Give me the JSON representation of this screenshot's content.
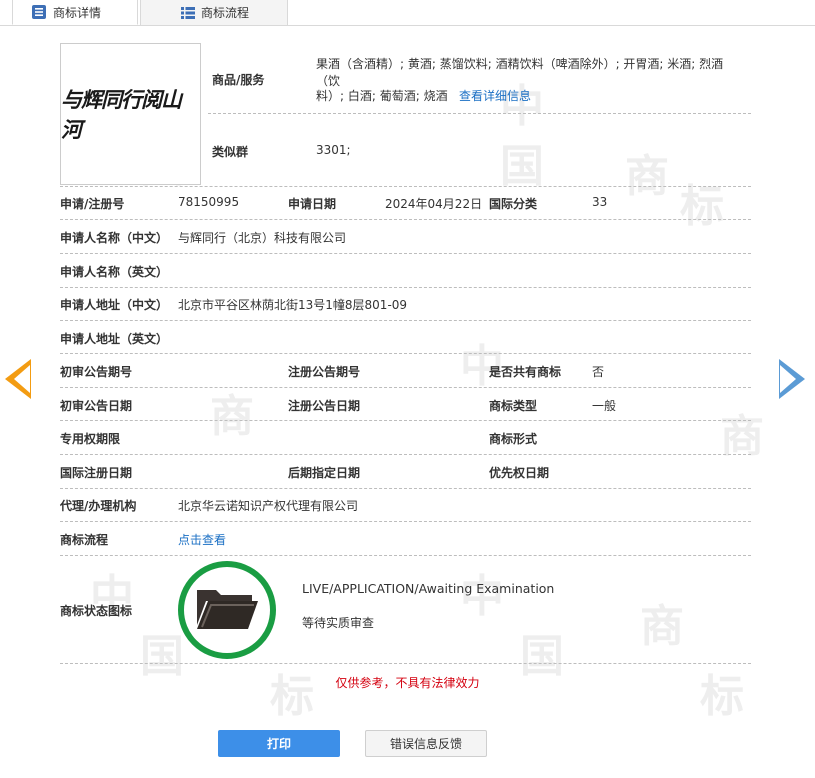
{
  "tabs": [
    {
      "label": "商标详情",
      "active": true
    },
    {
      "label": "商标流程",
      "active": false
    }
  ],
  "watermark": [
    "中",
    "国",
    "商",
    "标"
  ],
  "logo": {
    "text": "与辉同行阅山河"
  },
  "top": {
    "goods_label": "商品/服务",
    "goods_value_line1": "果酒（含酒精）; 黄酒; 蒸馏饮料; 酒精饮料（啤酒除外）; 开胃酒; 米酒; 烈酒（饮",
    "goods_value_line2": "料）; 白酒; 葡萄酒; 烧酒",
    "goods_link": "查看详细信息",
    "group_label": "类似群",
    "group_value": "3301;"
  },
  "rows": {
    "reg_no_label": "申请/注册号",
    "reg_no": "78150995",
    "app_date_label": "申请日期",
    "app_date": "2024年04月22日",
    "intl_class_label": "国际分类",
    "intl_class": "33",
    "applicant_cn_label": "申请人名称（中文）",
    "applicant_cn": "与辉同行（北京）科技有限公司",
    "applicant_en_label": "申请人名称（英文）",
    "address_cn_label": "申请人地址（中文）",
    "address_cn": "北京市平谷区林荫北街13号1幢8层801-09",
    "address_en_label": "申请人地址（英文）",
    "prelim_no_label": "初审公告期号",
    "reg_pub_no_label": "注册公告期号",
    "shared_label": "是否共有商标",
    "shared": "否",
    "prelim_date_label": "初审公告日期",
    "reg_pub_date_label": "注册公告日期",
    "type_label": "商标类型",
    "type": "一般",
    "exclusive_label": "专用权期限",
    "form_label": "商标形式",
    "intl_reg_date_label": "国际注册日期",
    "later_date_label": "后期指定日期",
    "priority_label": "优先权日期",
    "agent_label": "代理/办理机构",
    "agent": "北京华云诺知识产权代理有限公司",
    "flow_label": "商标流程",
    "flow_link": "点击查看",
    "status_label": "商标状态图标",
    "status_en": "LIVE/APPLICATION/Awaiting Examination",
    "status_cn": "等待实质审查"
  },
  "disclaimer": "仅供参考，不具有法律效力",
  "buttons": {
    "print": "打印",
    "feedback": "错误信息反馈"
  },
  "colors": {
    "accent": "#3d8fe8",
    "status_ring": "#1a9d43",
    "prev_arrow": "#f39c12",
    "next_arrow": "#5b9bd5",
    "warning": "#d4000f"
  }
}
